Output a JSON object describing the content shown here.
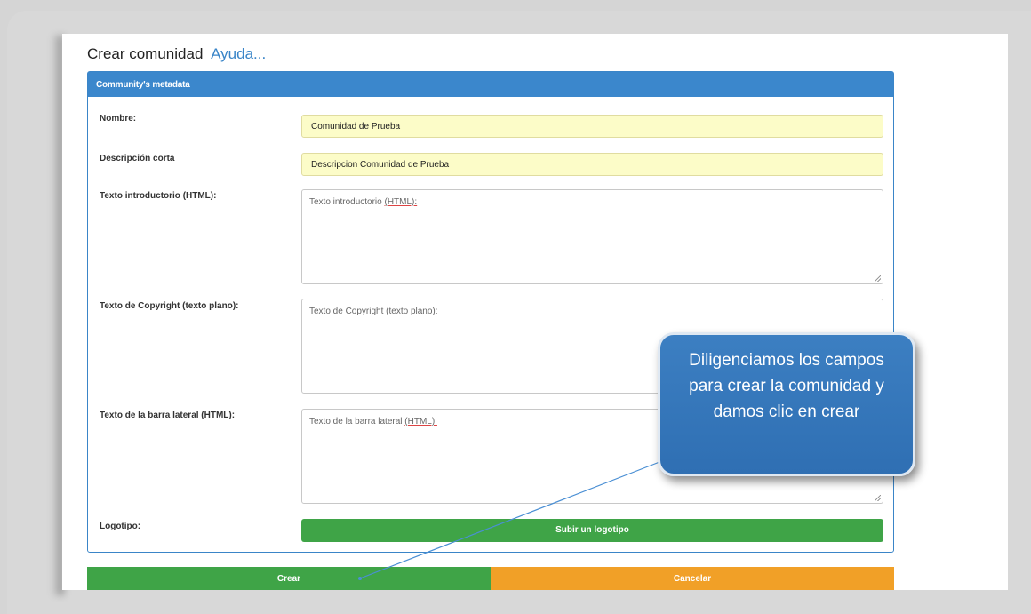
{
  "page": {
    "title": "Crear comunidad",
    "help_link": "Ayuda..."
  },
  "panel": {
    "header": "Community's metadata"
  },
  "form": {
    "name_label": "Nombre:",
    "name_value": "Comunidad de Prueba",
    "short_desc_label": "Descripción corta",
    "short_desc_value": "Descripcion Comunidad de Prueba",
    "intro_label": "Texto introductorio (HTML):",
    "intro_placeholder_text": "Texto introductorio",
    "intro_placeholder_html": "(HTML):",
    "copyright_label": "Texto de Copyright (texto plano):",
    "copyright_placeholder": "Texto de Copyright (texto plano):",
    "sidebar_label": "Texto de la barra lateral (HTML):",
    "sidebar_placeholder_text": "Texto de la barra lateral",
    "sidebar_placeholder_html": "(HTML):",
    "logo_label": "Logotipo:",
    "upload_logo_label": "Subir un logotipo"
  },
  "actions": {
    "create_label": "Crear",
    "cancel_label": "Cancelar"
  },
  "callout": {
    "text": "Diligenciamos los campos para crear la comunidad y damos clic en crear"
  },
  "colors": {
    "panel_header": "#3b87cc",
    "filled_field": "#fcfcc8",
    "create_button": "#3fa447",
    "cancel_button": "#f1a027",
    "callout": "#2f6fb3"
  }
}
